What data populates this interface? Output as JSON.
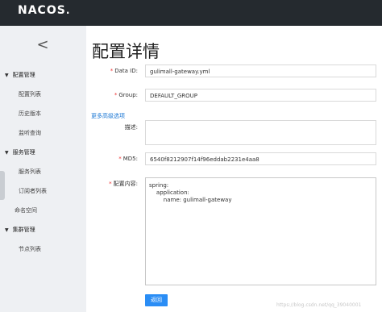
{
  "brand": {
    "name": "NACOS",
    "mark": "."
  },
  "sidebar": {
    "back_glyph": "<",
    "groups": [
      {
        "label": "配置管理",
        "items": [
          "配置列表",
          "历史版本",
          "监听查询"
        ]
      },
      {
        "label": "服务管理",
        "items": [
          "服务列表",
          "订阅者列表"
        ]
      },
      {
        "label": "命名空间"
      },
      {
        "label": "集群管理",
        "items": [
          "节点列表"
        ]
      }
    ]
  },
  "page": {
    "title": "配置详情",
    "data_id_label": "Data ID:",
    "data_id_value": "gulimall-gateway.yml",
    "group_label": "Group:",
    "group_value": "DEFAULT_GROUP",
    "advanced_link": "更多高级选项",
    "desc_label": "描述:",
    "desc_value": "",
    "md5_label": "MD5:",
    "md5_value": "6540f8212907f14f96eddab2231e4aa8",
    "content_label": "配置内容:",
    "content_value": "spring:\n    application:\n        name: gulimall-gateway",
    "back_label": "返回",
    "required_mark": "*"
  },
  "watermark": "https://blog.csdn.net/qq_39040001"
}
